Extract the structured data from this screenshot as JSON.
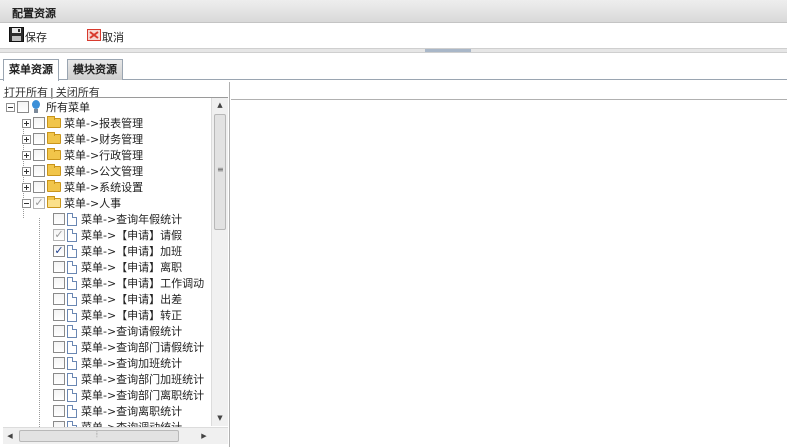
{
  "header": {
    "title": "配置资源"
  },
  "toolbar": {
    "save_label": "保存",
    "cancel_label": "取消"
  },
  "tabs": [
    {
      "label": "菜单资源",
      "active": true
    },
    {
      "label": "模块资源",
      "active": false
    }
  ],
  "tree_links": {
    "expand_all": "打开所有",
    "separator": "|",
    "collapse_all": "关闭所有"
  },
  "tree": {
    "root_label": "所有菜单",
    "folders": [
      {
        "label": "菜单->报表管理",
        "expanded": false,
        "checked": false
      },
      {
        "label": "菜单->财务管理",
        "expanded": false,
        "checked": false
      },
      {
        "label": "菜单->行政管理",
        "expanded": false,
        "checked": false
      },
      {
        "label": "菜单->公文管理",
        "expanded": false,
        "checked": false
      },
      {
        "label": "菜单->系统设置",
        "expanded": false,
        "checked": false
      },
      {
        "label": "菜单->人事",
        "expanded": true,
        "checked": "partial"
      }
    ],
    "hr_items": [
      {
        "label": "菜单->查询年假统计",
        "checked": false
      },
      {
        "label": "菜单->【申请】请假",
        "checked": "partial"
      },
      {
        "label": "菜单->【申请】加班",
        "checked": true
      },
      {
        "label": "菜单->【申请】离职",
        "checked": false
      },
      {
        "label": "菜单->【申请】工作调动",
        "checked": false
      },
      {
        "label": "菜单->【申请】出差",
        "checked": false
      },
      {
        "label": "菜单->【申请】转正",
        "checked": false
      },
      {
        "label": "菜单->查询请假统计",
        "checked": false
      },
      {
        "label": "菜单->查询部门请假统计",
        "checked": false
      },
      {
        "label": "菜单->查询加班统计",
        "checked": false
      },
      {
        "label": "菜单->查询部门加班统计",
        "checked": false
      },
      {
        "label": "菜单->查询部门离职统计",
        "checked": false
      },
      {
        "label": "菜单->查询离职统计",
        "checked": false
      },
      {
        "label": "菜单->查询调动统计",
        "checked": false
      }
    ]
  },
  "icons": {
    "save": "floppy-disk-icon",
    "cancel": "cancel-icon",
    "root": "globe-icon",
    "folder": "folder-icon",
    "page": "page-icon"
  },
  "colors": {
    "cancel_red": "#d83a2e",
    "checkbox_check": "#1c3d8c"
  }
}
